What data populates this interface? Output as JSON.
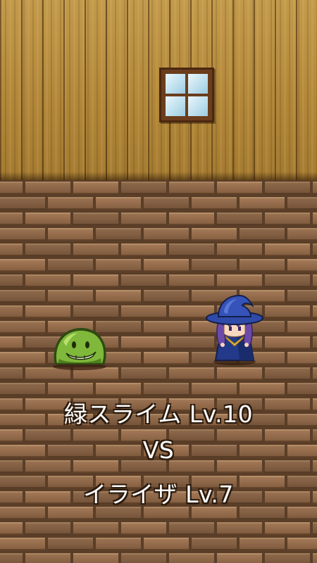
{
  "battle": {
    "enemy_label": "緑スライム Lv.10",
    "versus_label": "VS",
    "hero_label": "イライザ Lv.7"
  },
  "scene": {
    "wall": "wooden-plank-wall",
    "floor": "brick-floor",
    "window": "four-pane-window"
  },
  "colors": {
    "slime_body": "#7fb83a",
    "slime_dark": "#4f7f1e",
    "hero_hat": "#2f4aa8",
    "hero_hair": "#6b4aa8",
    "text": "#ffffff"
  }
}
